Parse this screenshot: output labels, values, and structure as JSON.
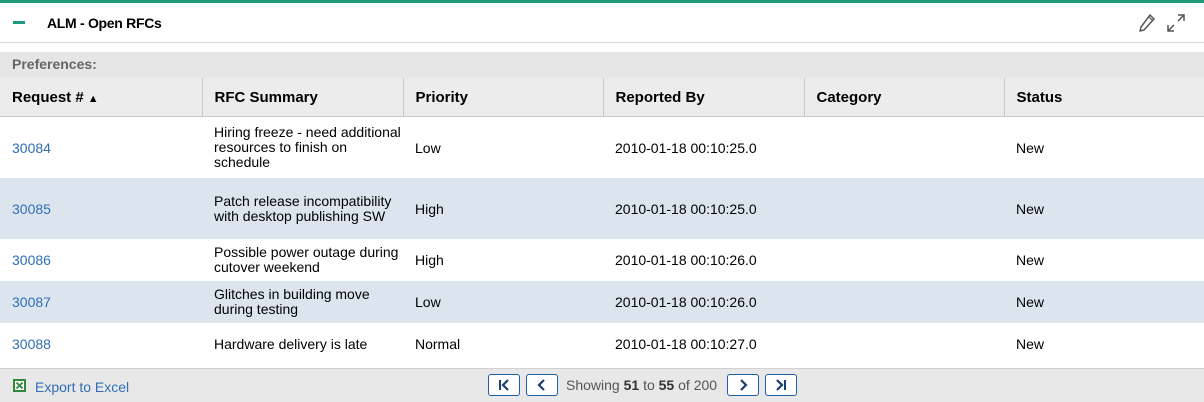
{
  "portlet": {
    "title": "ALM - Open RFCs"
  },
  "preferences_label": "Preferences:",
  "columns": {
    "request": "Request #",
    "summary": "RFC Summary",
    "priority": "Priority",
    "reported_by": "Reported By",
    "category": "Category",
    "status": "Status"
  },
  "rows": [
    {
      "id": "30084",
      "summary": "Hiring freeze - need additional resources to finish on schedule",
      "priority": "Low",
      "reported": "2010-01-18 00:10:25.0",
      "category": "",
      "status": "New"
    },
    {
      "id": "30085",
      "summary": "Patch release incompatibility with desktop publishing SW",
      "priority": "High",
      "reported": "2010-01-18 00:10:25.0",
      "category": "",
      "status": "New"
    },
    {
      "id": "30086",
      "summary": "Possible power outage during cutover weekend",
      "priority": "High",
      "reported": "2010-01-18 00:10:26.0",
      "category": "",
      "status": "New"
    },
    {
      "id": "30087",
      "summary": "Glitches in building move during testing",
      "priority": "Low",
      "reported": "2010-01-18 00:10:26.0",
      "category": "",
      "status": "New"
    },
    {
      "id": "30088",
      "summary": "Hardware delivery is late",
      "priority": "Normal",
      "reported": "2010-01-18 00:10:27.0",
      "category": "",
      "status": "New"
    }
  ],
  "footer": {
    "export_label": "Export to Excel",
    "showing_prefix": "Showing",
    "range_start": "51",
    "range_to": "to",
    "range_end": "55",
    "of_label": "of",
    "total": "200"
  },
  "colors": {
    "accent": "#1e9a7c",
    "link": "#2f6fb6",
    "alt_row": "#dce5ee",
    "pager_border": "#1f5fa8"
  },
  "icons": {
    "collapse": "minus-icon",
    "edit": "pencil-icon",
    "maximize": "expand-icon",
    "export": "excel-icon"
  }
}
